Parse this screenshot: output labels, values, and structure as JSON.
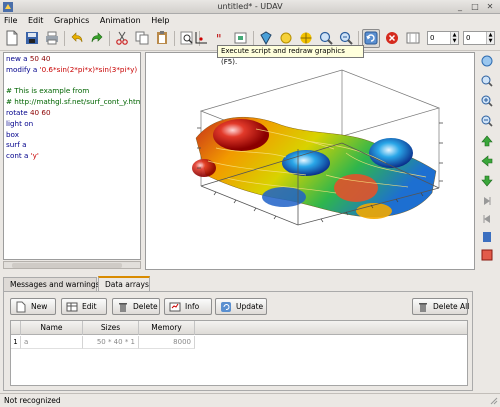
{
  "window": {
    "title": "untitled* - UDAV"
  },
  "menu": [
    "File",
    "Edit",
    "Graphics",
    "Animation",
    "Help"
  ],
  "toolbar": {
    "spin1_value": "0",
    "spin2_value": "0",
    "tooltip": "Execute script and redraw graphics (F5)."
  },
  "editor": {
    "lines": [
      [
        {
          "t": "new a ",
          "c": "kw"
        },
        {
          "t": "50 40",
          "c": "num"
        }
      ],
      [
        {
          "t": "modify a ",
          "c": "kw"
        },
        {
          "t": "'0.6*sin(2*pi*x)*sin(3*pi*y)",
          "c": "str"
        }
      ],
      [
        {
          "t": "",
          "c": "kw"
        }
      ],
      [
        {
          "t": "# This is example from",
          "c": "cmt"
        }
      ],
      [
        {
          "t": "# http://mathgl.sf.net/surf_cont_y.html",
          "c": "cmt"
        }
      ],
      [
        {
          "t": "rotate ",
          "c": "kw"
        },
        {
          "t": "40 60",
          "c": "num"
        }
      ],
      [
        {
          "t": "light on",
          "c": "kw"
        }
      ],
      [
        {
          "t": "box",
          "c": "kw"
        }
      ],
      [
        {
          "t": "surf a",
          "c": "kw"
        }
      ],
      [
        {
          "t": "cont a ",
          "c": "kw"
        },
        {
          "t": "'y'",
          "c": "str"
        }
      ]
    ]
  },
  "tabs": [
    "Messages and warnings",
    "Data arrays"
  ],
  "panel": {
    "buttons": {
      "new": "New",
      "edit": "Edit",
      "delete": "Delete",
      "info": "Info",
      "update": "Update",
      "delete_all": "Delete All"
    }
  },
  "table": {
    "headers": [
      "Name",
      "Sizes",
      "Memory"
    ],
    "rows": [
      {
        "index": "1",
        "name": "a",
        "sizes": "50 * 40 * 1",
        "memory": "8000"
      }
    ]
  },
  "status": "Not recognized",
  "colors": {
    "accent_tab": "#d98b00",
    "tooltip_bg": "#ffffdc",
    "keyword": "#00008b",
    "number": "#8b0000",
    "string": "#c80000",
    "comment": "#006400"
  }
}
